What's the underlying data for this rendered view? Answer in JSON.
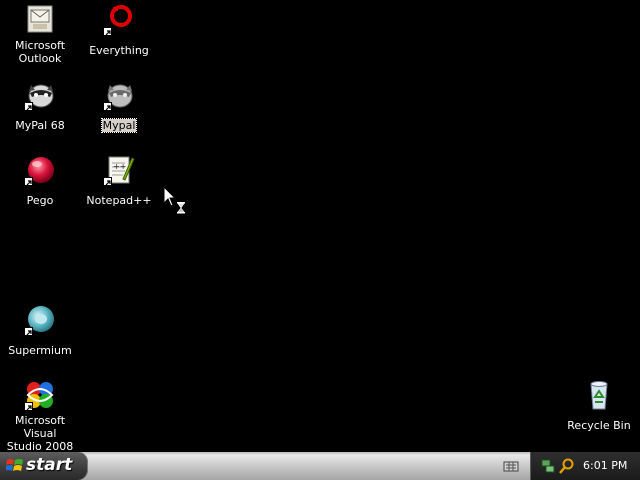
{
  "desktop": {
    "icons": [
      {
        "label": "Microsoft\nOutlook"
      },
      {
        "label": "Everything"
      },
      {
        "label": "MyPal 68"
      },
      {
        "label": "Mypal"
      },
      {
        "label": "Pego"
      },
      {
        "label": "Notepad++"
      },
      {
        "label": "Supermium"
      },
      {
        "label": "Microsoft Visual\nStudio 2008"
      },
      {
        "label": "Recycle Bin"
      }
    ]
  },
  "taskbar": {
    "start_label": "start",
    "clock": "6:01 PM"
  },
  "colors": {
    "desktop_background": "#000000",
    "selection_highlight": "#d4d0c8"
  }
}
